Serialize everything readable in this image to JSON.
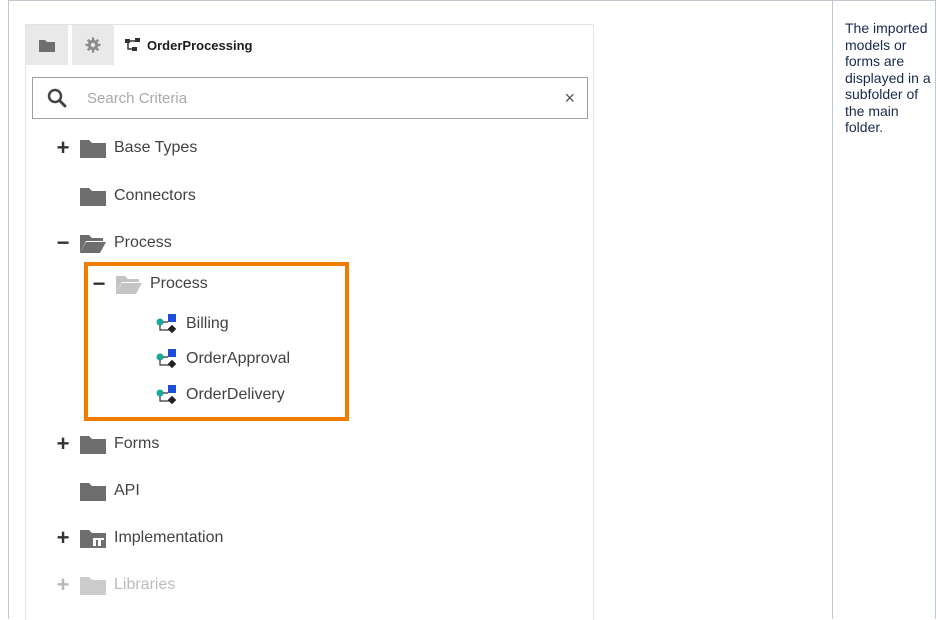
{
  "tabs": {
    "model_name": "OrderProcessing"
  },
  "search": {
    "placeholder": "Search Criteria",
    "value": "",
    "clear_glyph": "×"
  },
  "tree": {
    "base_types": "Base Types",
    "connectors": "Connectors",
    "process": "Process",
    "process_sub": "Process",
    "billing": "Billing",
    "order_approval": "OrderApproval",
    "order_delivery": "OrderDelivery",
    "forms": "Forms",
    "api": "API",
    "implementation": "Implementation",
    "libraries": "Libraries"
  },
  "toggles": {
    "expand": "+",
    "collapse": "−"
  },
  "note": "The imported models or forms are displayed in a subfolder of the main folder.",
  "colors": {
    "highlight": "#f07d00",
    "folder": "#6e6e6e",
    "bpmn_teal": "#17a99a",
    "bpmn_blue": "#1d4ed8"
  },
  "icons": [
    "folder-icon",
    "gear-icon",
    "model-tree-icon",
    "search-icon",
    "close-icon",
    "folder-open-icon",
    "process-model-icon",
    "folder-grid-icon"
  ]
}
